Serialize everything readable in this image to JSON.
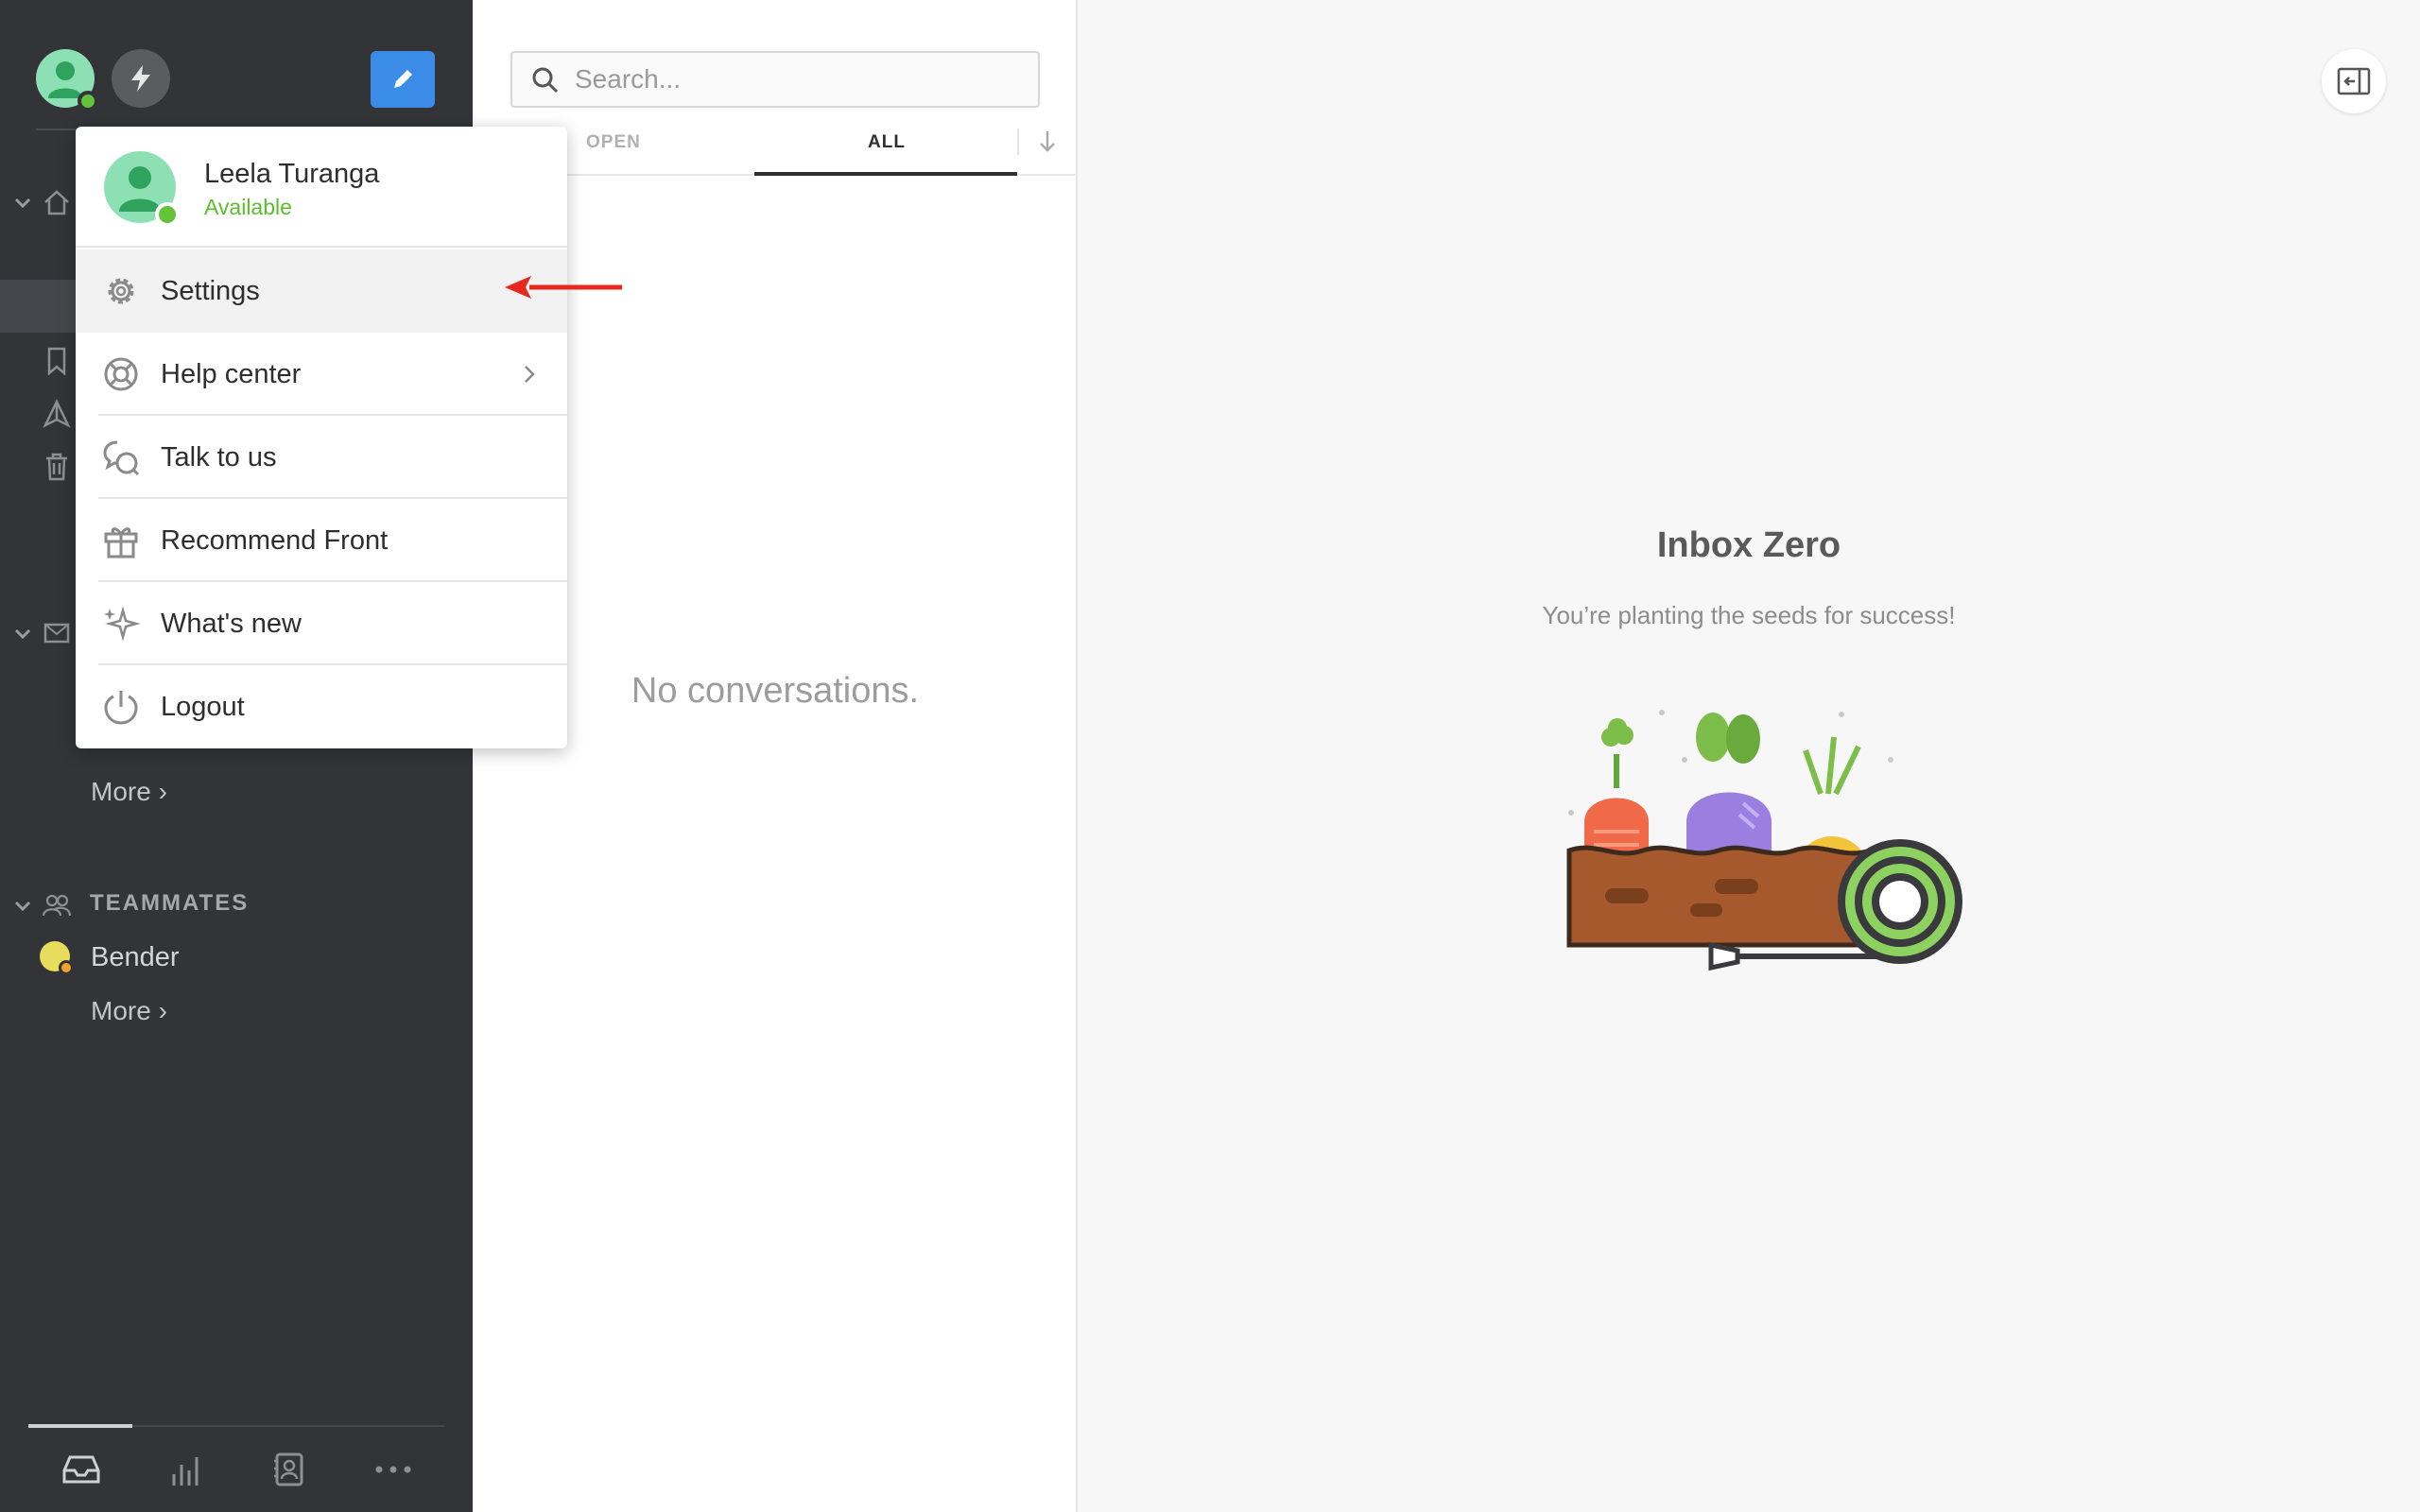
{
  "user": {
    "name": "Leela Turanga",
    "status": "Available"
  },
  "menu": {
    "items": [
      {
        "label": "Settings",
        "icon": "gear-icon"
      },
      {
        "label": "Help center",
        "icon": "lifebuoy-icon"
      },
      {
        "label": "Talk to us",
        "icon": "chat-bubbles-icon"
      },
      {
        "label": "Recommend Front",
        "icon": "gift-icon"
      },
      {
        "label": "What's new",
        "icon": "sparkles-icon"
      },
      {
        "label": "Logout",
        "icon": "power-icon"
      }
    ]
  },
  "sidebar": {
    "more_label_1": "More ›",
    "teammates_title": "TEAMMATES",
    "teammate_name": "Bender",
    "more_label_2": "More ›"
  },
  "list": {
    "search_placeholder": "Search...",
    "tab_open": "OPEN",
    "tab_all": "ALL",
    "empty": "No conversations."
  },
  "main": {
    "title": "Inbox Zero",
    "subtitle": "You’re planting the seeds for success!"
  },
  "colors": {
    "sidebar_bg": "#333438",
    "accent_blue": "#3b8ce6",
    "available_green": "#5bbd2d",
    "annotation_red": "#e8281e"
  }
}
